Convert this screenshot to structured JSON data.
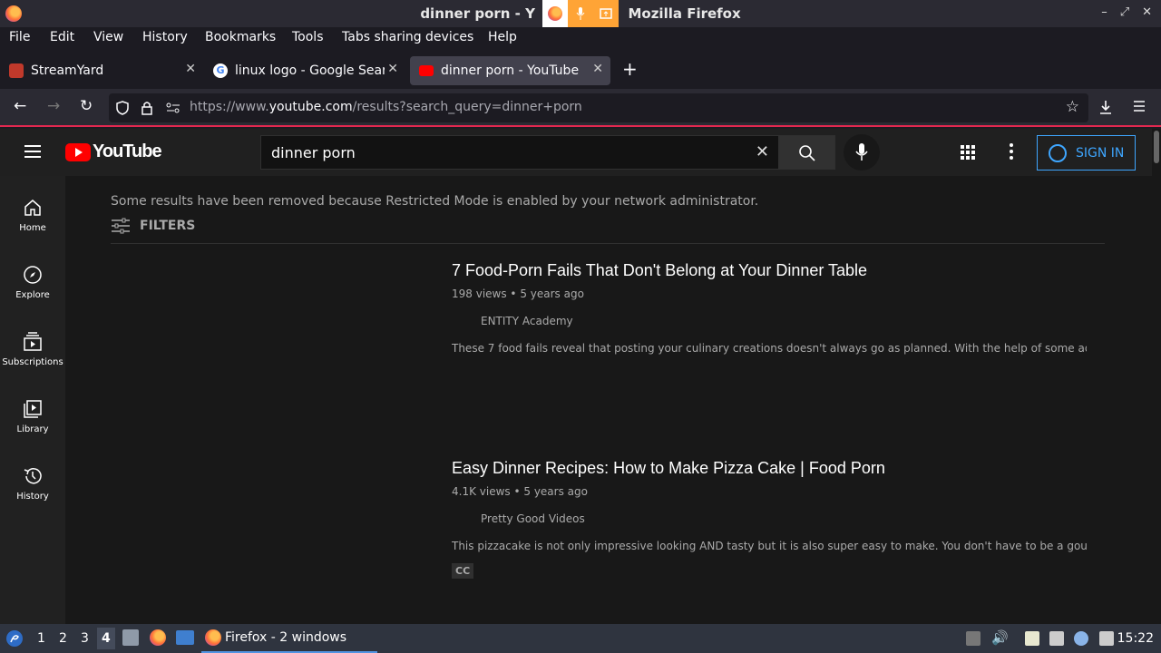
{
  "window": {
    "title": "dinner porn - YouTube — Mozilla Firefox",
    "title_visible": "dinner porn - Y",
    "title_suffix": "Mozilla Firefox"
  },
  "menu": [
    "File",
    "Edit",
    "View",
    "History",
    "Bookmarks",
    "Tools",
    "Tabs sharing devices",
    "Help"
  ],
  "tabs": [
    {
      "label": "StreamYard",
      "favicon_color": "#c0392b"
    },
    {
      "label": "linux logo - Google Search",
      "favicon_color": "#ffffff"
    },
    {
      "label": "dinner porn - YouTube",
      "favicon_color": "#ff0000",
      "active": true
    }
  ],
  "url": {
    "prefix": "https://www.",
    "domain": "youtube.com",
    "path": "/results?search_query=dinner+porn"
  },
  "youtube": {
    "logo_text": "YouTube",
    "search_value": "dinner porn",
    "sign_in": "SIGN IN",
    "guide": [
      {
        "label": "Home",
        "icon": "home-icon"
      },
      {
        "label": "Explore",
        "icon": "compass-icon"
      },
      {
        "label": "Subscriptions",
        "icon": "subscriptions-icon"
      },
      {
        "label": "Library",
        "icon": "library-icon"
      },
      {
        "label": "History",
        "icon": "history-icon"
      }
    ],
    "notice": "Some results have been removed because Restricted Mode is enabled by your network administrator.",
    "filters_label": "FILTERS",
    "results": [
      {
        "title": "7 Food-Porn Fails That Don't Belong at Your Dinner Table",
        "views": "198 views",
        "age": "5 years ago",
        "channel": "ENTITY Academy",
        "description": "These 7 food fails reveal that posting your culinary creations doesn't always go as planned. With the help of some adorable food ..."
      },
      {
        "title": "Easy Dinner Recipes: How to Make Pizza Cake | Food Porn",
        "views": "4.1K views",
        "age": "5 years ago",
        "channel": "Pretty Good Videos",
        "description": "This pizzacake is not only impressive looking AND tasty but it is also super easy to make. You don't have to be a gourmet chef to ...",
        "badge": "CC"
      }
    ]
  },
  "taskbar": {
    "workspaces": [
      "1",
      "2",
      "3",
      "4"
    ],
    "active_workspace": "4",
    "task_label": "Firefox - 2 windows",
    "clock": "15:22"
  },
  "colors": {
    "accent_blue": "#3ea6ff",
    "youtube_red": "#ff0000",
    "share_indicator": "#ffa436"
  }
}
